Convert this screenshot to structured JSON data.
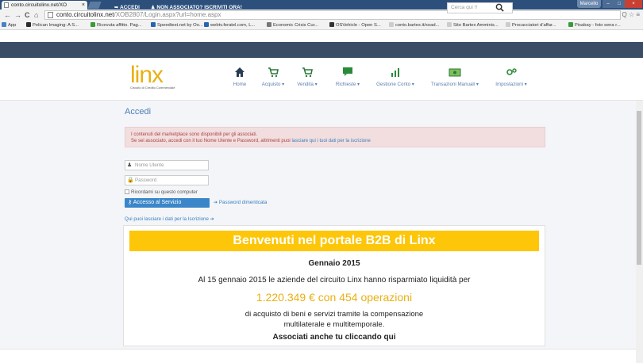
{
  "browser": {
    "tab_title": "conto.circuitolinx.net/XO",
    "tab_close": "×",
    "window_user": "Marcello",
    "window_min": "–",
    "window_max": "□",
    "window_close": "×",
    "url_host": "conto.circuitolinx.net",
    "url_path": "/XOB2807/Login.aspx?url=home.aspx",
    "nav_back": "←",
    "nav_forward": "→",
    "nav_reload": "C",
    "nav_home": "⌂",
    "right_icons": "Q ☆ ≡",
    "bookmarks": [
      {
        "label": "App",
        "color": "#4a80c8"
      },
      {
        "label": "Pelican Imaging: A S...",
        "color": "#2b2b2b"
      },
      {
        "label": "Ricevuta affitto. Pag...",
        "color": "#3a9a3a"
      },
      {
        "label": "Speedtest.net by Oo...",
        "color": "#2a64b0"
      },
      {
        "label": "webtv.feratel.com, L...",
        "color": "#2a64b0"
      },
      {
        "label": "Economic Crisis Cur...",
        "color": "#777777"
      },
      {
        "label": "OSVehicle - Open S...",
        "color": "#333333"
      },
      {
        "label": "conto.bartex.it/xoad...",
        "color": "#cccccc"
      },
      {
        "label": "Sito Bartex Amminis...",
        "color": "#cccccc"
      },
      {
        "label": "Procacciatori d'affar...",
        "color": "#cccccc"
      },
      {
        "label": "Pixabay - foto sena r...",
        "color": "#3a9a3a"
      }
    ]
  },
  "topbar": {
    "login_label": "ACCEDI",
    "register_label": "NON ASSOCIATO? ISCRIVITI ORA!",
    "search_placeholder": "Cerca qui !!"
  },
  "header": {
    "logo_text": "linx",
    "logo_sub": "Circuito di Credito Commerciale",
    "nav": [
      {
        "label": "Home",
        "icon": "home-icon"
      },
      {
        "label": "Acquisto ▾",
        "icon": "cart-icon"
      },
      {
        "label": "Vendita ▾",
        "icon": "cart-icon"
      },
      {
        "label": "Richieste ▾",
        "icon": "chat-icon"
      },
      {
        "label": "Gestione Conto ▾",
        "icon": "chart-icon"
      },
      {
        "label": "Transazioni Manuali ▾",
        "icon": "money-icon"
      },
      {
        "label": "Impostazioni ▾",
        "icon": "gears-icon"
      }
    ]
  },
  "login": {
    "title": "Accedi",
    "alert_line1": "I contenuti del marketplace sono disponibili per gli associati.",
    "alert_line2_pre": "Se sei associato, accedi con il tuo Nome Utente e Password, altrimenti puoi ",
    "alert_link": "lasciare qui i tuoi dati per la iscrizione",
    "username_placeholder": "Nome Utente",
    "password_placeholder": "Password",
    "remember_label": "Ricordami su questo computer",
    "submit_label": "Accesso al Servizio",
    "forgot_label": "Password dimenticata",
    "signup_label": "Qui puoi lasciare i dati per la Iscrizione"
  },
  "welcome": {
    "banner": "Benvenuti nel portale B2B di Linx",
    "month": "Gennaio 2015",
    "intro": "Al 15 gennaio 2015 le aziende del circuito Linx hanno risparmiato liquidità per",
    "amount": "1.220.349 € con 454 operazioni",
    "desc_line1": "di acquisto di beni e servizi tramite la compensazione",
    "desc_line2": "multilaterale e multitemporale.",
    "cta": "Associati anche tu cliccando qui"
  },
  "colors": {
    "accent_yellow": "#fdc608",
    "link_blue": "#3a7fc0",
    "topbar_bg": "#3b4c66",
    "alert_bg": "#f2dede"
  }
}
